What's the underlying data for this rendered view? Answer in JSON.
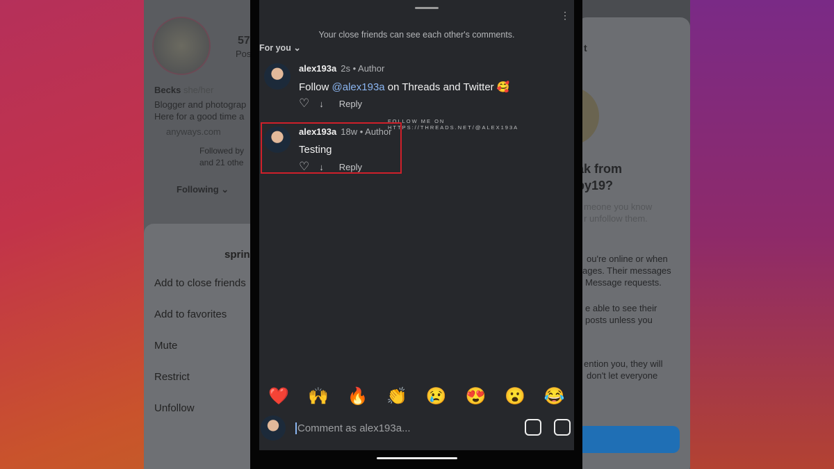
{
  "left_panel": {
    "stats_number": "57",
    "stats_label": "Pos",
    "name": "Becks",
    "name_extra": "she/her",
    "bio": [
      "Blogger and photograp",
      "Here for a good time a"
    ],
    "link": "anyways.com",
    "followed_by": [
      "Followed by",
      "and 21 othe"
    ],
    "following_button": "Following ⌄",
    "sheet": {
      "title": "sprin",
      "items": [
        "Add to close friends",
        "Add to favorites",
        "Mute",
        "Restrict",
        "Unfollow"
      ]
    }
  },
  "comments_sheet": {
    "notice": "Your close friends can see each other's comments.",
    "filter": "For you",
    "comments": [
      {
        "user": "alex193a",
        "time": "2s",
        "role": "Author",
        "text_before": "Follow ",
        "mention": "@alex193a",
        "text_after": " on Threads and Twitter 🥰",
        "reply": "Reply"
      },
      {
        "user": "alex193a",
        "time": "18w",
        "role": "Author",
        "text_before": "Testing",
        "mention": "",
        "text_after": "",
        "reply": "Reply",
        "highlighted": true
      }
    ],
    "watermark": "FOLLOW ME ON HTTPS://THREADS.NET/@ALEX193A",
    "reactions": [
      "❤️",
      "🙌",
      "🔥",
      "👏",
      "😢",
      "😍",
      "😮",
      "😂"
    ],
    "comment_placeholder": "Comment as alex193a...",
    "highlight_color": "#d0202a"
  },
  "right_panel": {
    "title": "t",
    "heading": [
      "ak from",
      "by19?"
    ],
    "sub": [
      "meone you know",
      "r unfollow them."
    ],
    "paragraphs": [
      "ou're online or when",
      "ages. Their messages",
      "Message requests.",
      "e able to see their",
      "posts unless you",
      "ention you, they will",
      "don't let everyone"
    ],
    "button_color": "#1f6fb5"
  }
}
